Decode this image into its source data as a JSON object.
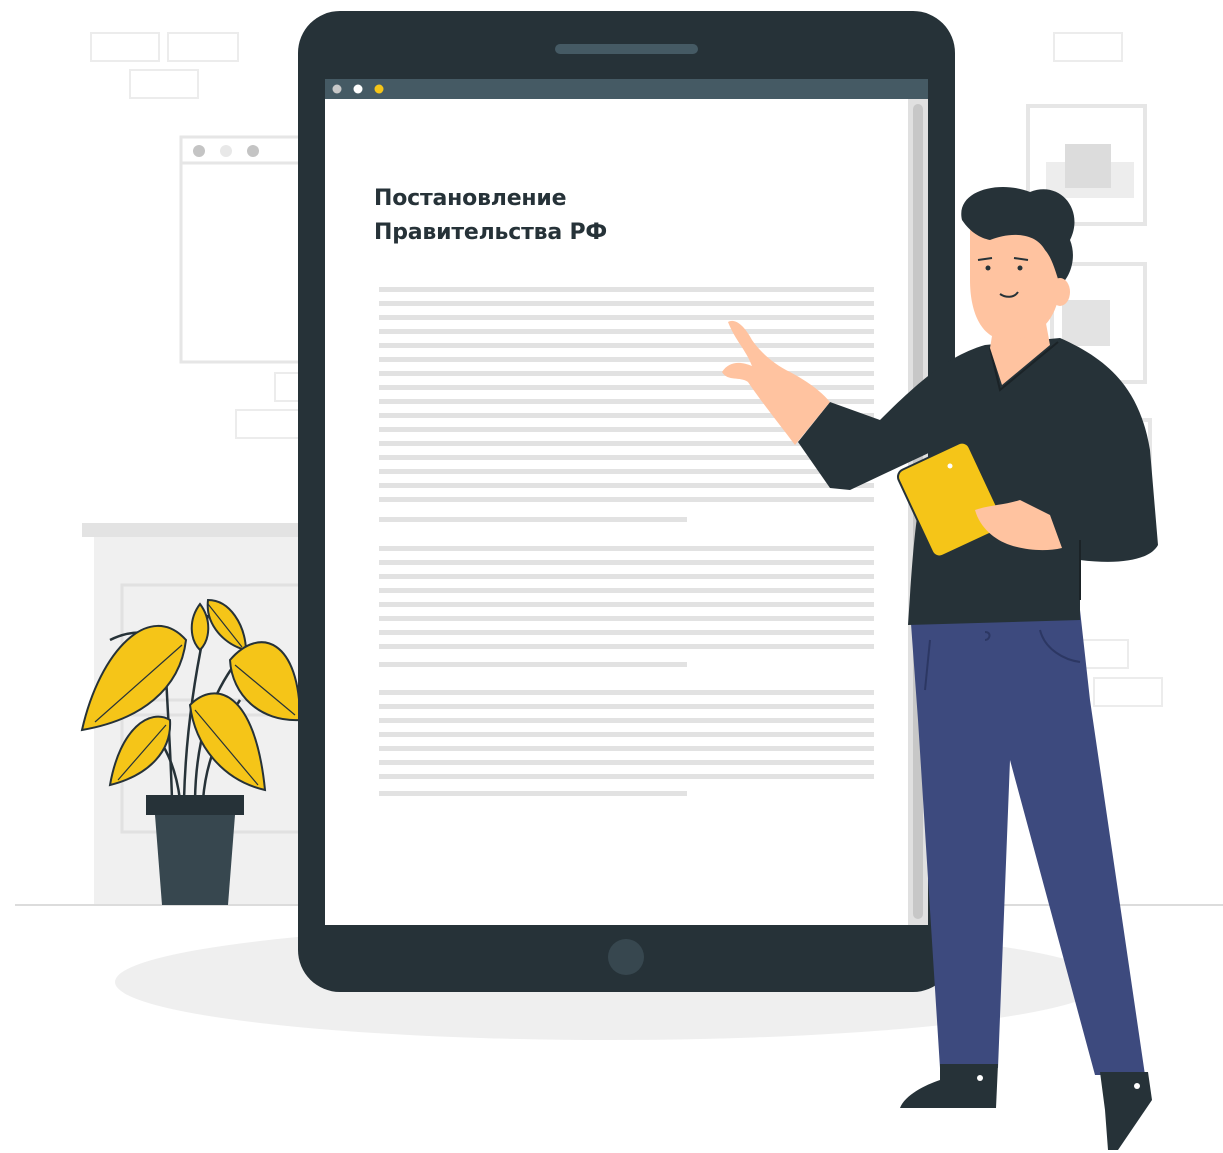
{
  "document": {
    "title_line1": "Постановление",
    "title_line2": "Правительства РФ"
  },
  "window_dots": [
    "gray",
    "white",
    "yellow"
  ],
  "icons": [
    "tablet-home-button",
    "tablet-speaker"
  ],
  "colors": {
    "tablet_frame": "#263238",
    "screen": "#ffffff",
    "browser_bar": "#455a64",
    "text_lines": "#e0e0e0",
    "accent_yellow": "#f5c518",
    "shirt": "#263238",
    "jeans": "#3d4a7e",
    "skin": "#ffc3a0",
    "floor_shadow": "#f0f0f0",
    "plant_pot": "#37474f"
  }
}
